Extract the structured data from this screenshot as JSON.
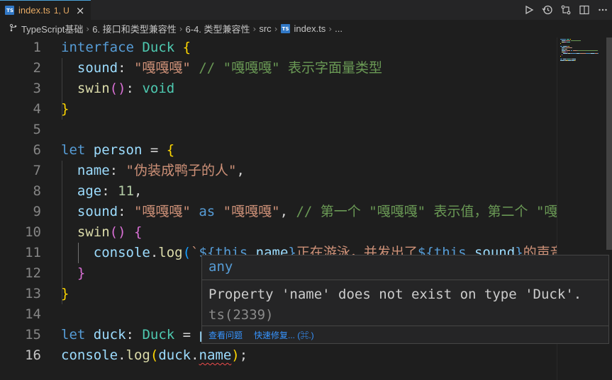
{
  "tab": {
    "filename": "index.ts",
    "status": "1, U",
    "close": "×",
    "badge": "TS"
  },
  "breadcrumb": [
    "TypeScript基础",
    "6. 接口和类型兼容性",
    "6-4. 类型兼容性",
    "src",
    "index.ts",
    "..."
  ],
  "editor": {
    "active_line": 16,
    "lines": [
      [
        [
          "kw",
          "interface"
        ],
        [
          "op",
          " "
        ],
        [
          "ty",
          "Duck"
        ],
        [
          "op",
          " "
        ],
        [
          "br1",
          "{"
        ]
      ],
      [
        [
          "op",
          "  "
        ],
        [
          "prop",
          "sound"
        ],
        [
          "op",
          ": "
        ],
        [
          "str",
          "\"嘎嘎嘎\""
        ],
        [
          "op",
          " "
        ],
        [
          "com",
          "// \"嘎嘎嘎\" 表示字面量类型"
        ]
      ],
      [
        [
          "op",
          "  "
        ],
        [
          "fn",
          "swin"
        ],
        [
          "br2",
          "()"
        ],
        [
          "op",
          ": "
        ],
        [
          "ty",
          "void"
        ]
      ],
      [
        [
          "br1",
          "}"
        ]
      ],
      [],
      [
        [
          "kw",
          "let"
        ],
        [
          "op",
          " "
        ],
        [
          "prop",
          "person"
        ],
        [
          "op",
          " = "
        ],
        [
          "br1",
          "{"
        ]
      ],
      [
        [
          "op",
          "  "
        ],
        [
          "prop",
          "name"
        ],
        [
          "op",
          ": "
        ],
        [
          "str",
          "\"伪装成鸭子的人\""
        ],
        [
          "op",
          ","
        ]
      ],
      [
        [
          "op",
          "  "
        ],
        [
          "prop",
          "age"
        ],
        [
          "op",
          ": "
        ],
        [
          "num",
          "11"
        ],
        [
          "op",
          ","
        ]
      ],
      [
        [
          "op",
          "  "
        ],
        [
          "prop",
          "sound"
        ],
        [
          "op",
          ": "
        ],
        [
          "str",
          "\"嘎嘎嘎\""
        ],
        [
          "op",
          " "
        ],
        [
          "kw",
          "as"
        ],
        [
          "op",
          " "
        ],
        [
          "str",
          "\"嘎嘎嘎\""
        ],
        [
          "op",
          ", "
        ],
        [
          "com",
          "// 第一个 \"嘎嘎嘎\" 表示值，第二个 \"嘎嘎嘎\" 表示类型"
        ]
      ],
      [
        [
          "op",
          "  "
        ],
        [
          "fn",
          "swin"
        ],
        [
          "br2",
          "()"
        ],
        [
          "op",
          " "
        ],
        [
          "br2",
          "{"
        ]
      ],
      [
        [
          "op",
          "    "
        ],
        [
          "prop",
          "console"
        ],
        [
          "op",
          "."
        ],
        [
          "fn",
          "log"
        ],
        [
          "br3",
          "("
        ],
        [
          "str",
          "`"
        ],
        [
          "kw",
          "${"
        ],
        [
          "kw",
          "this"
        ],
        [
          "op",
          "."
        ],
        [
          "prop",
          "name"
        ],
        [
          "kw",
          "}"
        ],
        [
          "str",
          "正在游泳，并发出了"
        ],
        [
          "kw",
          "${"
        ],
        [
          "kw",
          "this"
        ],
        [
          "op",
          "."
        ],
        [
          "prop",
          "sound"
        ],
        [
          "kw",
          "}"
        ],
        [
          "str",
          "的声音`"
        ],
        [
          "br3",
          ")"
        ]
      ],
      [
        [
          "op",
          "  "
        ],
        [
          "br2",
          "}"
        ]
      ],
      [
        [
          "br1",
          "}"
        ]
      ],
      [],
      [
        [
          "kw",
          "let"
        ],
        [
          "op",
          " "
        ],
        [
          "prop",
          "duck"
        ],
        [
          "op",
          ": "
        ],
        [
          "ty",
          "Duck"
        ],
        [
          "op",
          " = "
        ],
        [
          "prop",
          "person"
        ]
      ],
      [
        [
          "prop",
          "console"
        ],
        [
          "op",
          "."
        ],
        [
          "fn",
          "log"
        ],
        [
          "br1",
          "("
        ],
        [
          "prop",
          "duck"
        ],
        [
          "op",
          "."
        ],
        [
          "err",
          "name"
        ],
        [
          "br1",
          ")"
        ],
        [
          "op",
          ";"
        ]
      ]
    ]
  },
  "hover": {
    "signature": "any",
    "message": "Property 'name' does not exist on type 'Duck'.",
    "code": "ts(2339)",
    "actions": [
      "查看问题",
      "快速修复... (⌘.)"
    ]
  },
  "colors": {
    "keyword": "#569cd6",
    "type": "#4ec9b0",
    "string": "#ce9178",
    "comment": "#6a9955",
    "error": "#f14c4c",
    "tab_modified": "#e8ab64"
  },
  "icons": [
    "run-icon",
    "timeline-icon",
    "compare-icon",
    "split-editor-icon",
    "more-icon"
  ]
}
